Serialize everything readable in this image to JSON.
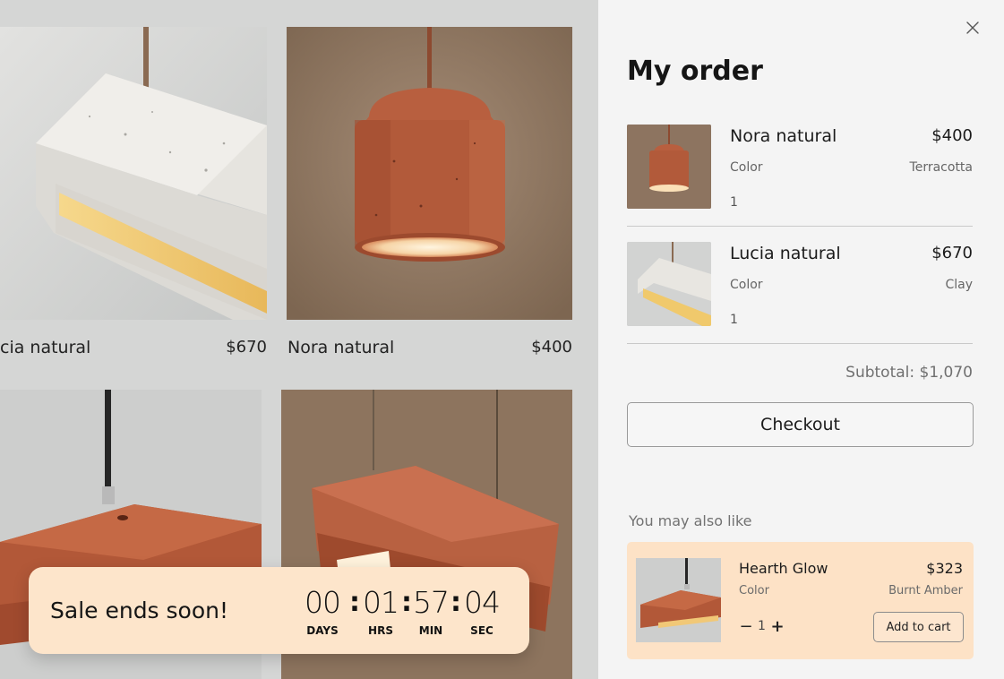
{
  "products": [
    {
      "name": "cia natural",
      "price": "$670"
    },
    {
      "name": "Nora natural",
      "price": "$400"
    }
  ],
  "sale": {
    "title": "Sale ends soon!",
    "countdown": [
      {
        "value": "00",
        "label": "DAYS"
      },
      {
        "value": "01",
        "label": "HRS"
      },
      {
        "value": "57",
        "label": "MIN"
      },
      {
        "value": "04",
        "label": "SEC"
      }
    ],
    "separator": ":"
  },
  "order": {
    "title": "My order",
    "items": [
      {
        "name": "Nora natural",
        "price": "$400",
        "color_label": "Color",
        "color_value": "Terracotta",
        "qty": "1"
      },
      {
        "name": "Lucia natural",
        "price": "$670",
        "color_label": "Color",
        "color_value": "Clay",
        "qty": "1"
      }
    ],
    "subtotal": "Subtotal: $1,070",
    "checkout_label": "Checkout"
  },
  "recommendations": {
    "title": "You may also like",
    "item": {
      "name": "Hearth Glow",
      "price": "$323",
      "color_label": "Color",
      "color_value": "Burnt Amber",
      "qty": "1",
      "minus": "−",
      "plus": "+",
      "add_label": "Add to cart"
    }
  },
  "colors": {
    "panel_bg": "#f4f4f4",
    "sale_bg": "#fde5cb",
    "rec_bg": "#fde2c6",
    "terracotta": "#b5603f"
  },
  "icons": {
    "close": "close-icon"
  }
}
